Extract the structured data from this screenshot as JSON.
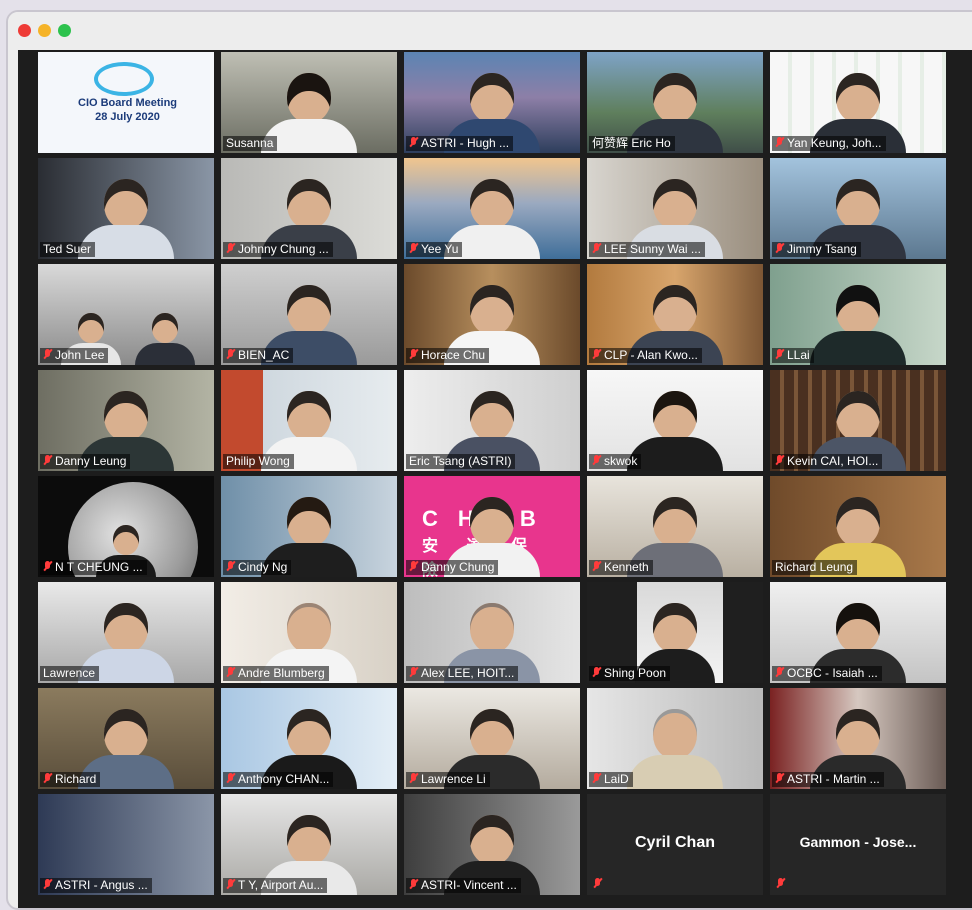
{
  "window": {
    "title": ""
  },
  "slide": {
    "title": "CIO Board Meeting",
    "date": "28 July 2020"
  },
  "participants": [
    {
      "name": "Susanna"
    },
    {
      "name": "ASTRI - Hugh ..."
    },
    {
      "name": "何赞辉 Eric Ho"
    },
    {
      "name": "Yan Keung, Joh..."
    },
    {
      "name": "Ted Suer"
    },
    {
      "name": "Johnny Chung ..."
    },
    {
      "name": "Yee Yu"
    },
    {
      "name": "LEE Sunny Wai ..."
    },
    {
      "name": "Jimmy Tsang"
    },
    {
      "name": "John Lee"
    },
    {
      "name": "BIEN_AC"
    },
    {
      "name": "Horace Chu"
    },
    {
      "name": "CLP - Alan Kwo..."
    },
    {
      "name": "LLai"
    },
    {
      "name": "Danny Leung"
    },
    {
      "name": "Philip Wong"
    },
    {
      "name": "Eric Tsang (ASTRI)"
    },
    {
      "name": "skwok"
    },
    {
      "name": "Kevin CAI, HOI..."
    },
    {
      "name": "N T CHEUNG ..."
    },
    {
      "name": "Cindy Ng"
    },
    {
      "name": "Danny Chung"
    },
    {
      "name": "Kenneth"
    },
    {
      "name": "Richard Leung"
    },
    {
      "name": "Lawrence"
    },
    {
      "name": "Andre Blumberg"
    },
    {
      "name": "Alex LEE, HOIT..."
    },
    {
      "name": "Shing Poon"
    },
    {
      "name": "OCBC - Isaiah ..."
    },
    {
      "name": "Richard"
    },
    {
      "name": "Anthony CHAN..."
    },
    {
      "name": "Lawrence Li"
    },
    {
      "name": "LaiD"
    },
    {
      "name": "ASTRI - Martin ..."
    },
    {
      "name": "ASTRI - Angus ..."
    },
    {
      "name": "T Y, Airport Au..."
    },
    {
      "name": "ASTRI- Vincent ..."
    },
    {
      "name": "Cyril Chan"
    },
    {
      "name": "Gammon - Jose..."
    }
  ],
  "banner_text": {
    "brand": "CH  B",
    "chinese": "安 達 保 險"
  },
  "colors": {
    "active_speaker": "#a4d66b",
    "muted": "#ff3b3b",
    "background": "#1d1d1d"
  }
}
